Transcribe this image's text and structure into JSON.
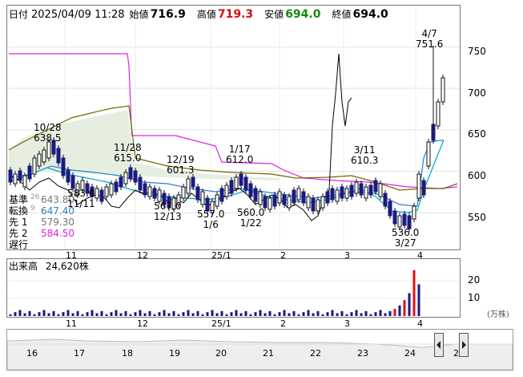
{
  "header": {
    "date_label": "日付",
    "date_value": "2025/04/09 11:28",
    "open_label": "始値",
    "open_value": "716.9",
    "high_label": "高値",
    "high_value": "719.3",
    "low_label": "安値",
    "low_value": "694.0",
    "close_label": "終値",
    "close_value": "694.0"
  },
  "legend": [
    {
      "key": "基準",
      "value": "643.80"
    },
    {
      "key": "転換",
      "value": "647.40"
    },
    {
      "key": "先 1",
      "value": "579.30"
    },
    {
      "key": "先 2",
      "value": "584.50"
    },
    {
      "key": "遅行",
      "value": ""
    }
  ],
  "legend_extra": {
    "kijun_period": "26",
    "tenkan_period": "9"
  },
  "price_axis": {
    "ticks": [
      "750",
      "700",
      "650",
      "600",
      "550"
    ]
  },
  "date_axis": {
    "ticks": [
      "11",
      "12",
      "25/1",
      "2",
      "3",
      "4"
    ]
  },
  "annotations": [
    {
      "date": "10/28",
      "price": "638.5"
    },
    {
      "date": "11/28",
      "price": "615.0"
    },
    {
      "date": "12/19",
      "price": "601.3"
    },
    {
      "date": "1/17",
      "price": "612.0"
    },
    {
      "date": "3/11",
      "price": "610.3"
    },
    {
      "date": "4/7",
      "price": "751.6"
    },
    {
      "date": "11/11",
      "price": "583.0"
    },
    {
      "date": "12/13",
      "price": "567.0"
    },
    {
      "date": "1/6",
      "price": "557.0"
    },
    {
      "date": "1/22",
      "price": "560.0"
    },
    {
      "date": "3/27",
      "price": "536.0"
    }
  ],
  "volume": {
    "title": "出来高",
    "value": "24,620株",
    "axis_ticks": [
      "20",
      "10"
    ],
    "unit": "(万株)"
  },
  "timeline": {
    "ticks": [
      "11",
      "12",
      "25/1",
      "2",
      "3",
      "4"
    ],
    "lower_ticks": [
      "16",
      "17",
      "18",
      "19",
      "20",
      "21",
      "22",
      "23",
      "24",
      "2"
    ]
  },
  "colors": {
    "up": "#ff2020",
    "down": "#1a1a80",
    "kijun": "#2b7ed0",
    "tenkan": "#00a4d4",
    "span1": "#6b6b00",
    "span2": "#e020e0",
    "chikou": "#000000",
    "cloud": "#e6eee0",
    "volume_down": "#1a1a80",
    "volume_up": "#e01010"
  },
  "chart_data": {
    "type": "candlestick",
    "ylim": [
      510,
      780
    ],
    "high": 751.6,
    "low": 536.0,
    "last": 694.0
  }
}
